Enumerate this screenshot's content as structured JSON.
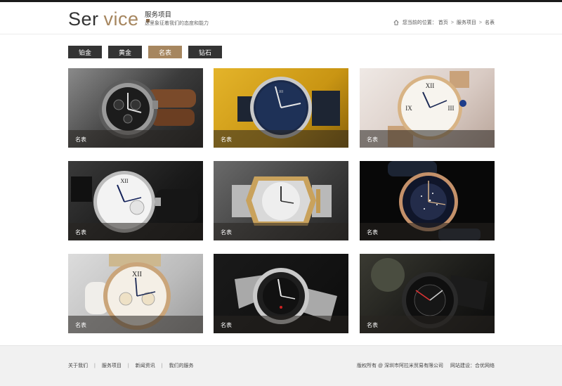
{
  "header": {
    "brand_part1": "Ser",
    "brand_part2": "vice",
    "subtitle_title": "服务项目",
    "subtitle_desc": "这里象征着我们的态度和能力",
    "breadcrumb": {
      "prefix": "您当前的位置：",
      "items": [
        "首页",
        "服务项目",
        "名表"
      ],
      "separator": ">"
    }
  },
  "tabs": [
    {
      "label": "铂金",
      "active": false
    },
    {
      "label": "黄金",
      "active": false
    },
    {
      "label": "名表",
      "active": true
    },
    {
      "label": "钻石",
      "active": false
    }
  ],
  "products": [
    {
      "caption": "名表"
    },
    {
      "caption": "名表"
    },
    {
      "caption": "名表"
    },
    {
      "caption": "名表"
    },
    {
      "caption": "名表"
    },
    {
      "caption": "名表"
    },
    {
      "caption": "名表"
    },
    {
      "caption": "名表"
    },
    {
      "caption": "名表"
    }
  ],
  "footer": {
    "links": [
      "关于我们",
      "服务项目",
      "新闻资讯",
      "我们的服务"
    ],
    "separator": "|",
    "copyright": "版权所有 @ 深圳市阿拉米贸易有限公司",
    "builder": "网站建设：合优网络"
  },
  "colors": {
    "accent": "#a6865f",
    "tab_dark": "#333333",
    "footer_bg": "#f1f1f1"
  }
}
